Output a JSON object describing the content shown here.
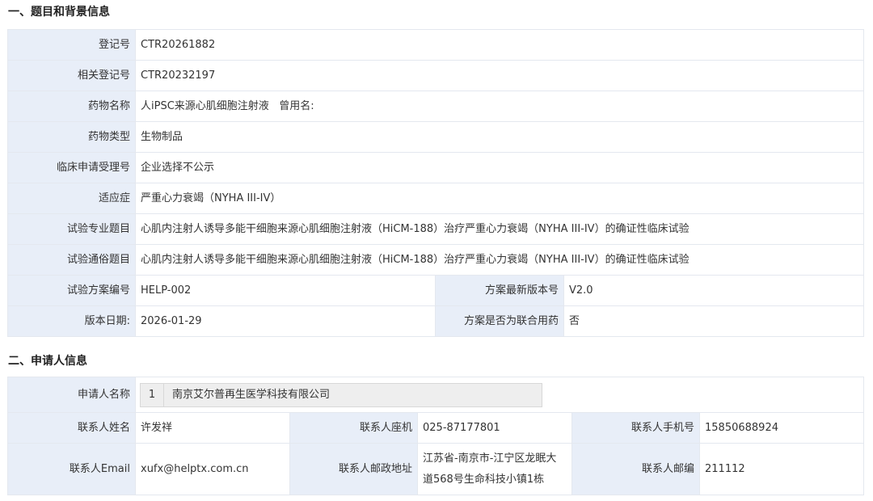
{
  "section1": {
    "title": "一、题目和背景信息",
    "registration_no": {
      "label": "登记号",
      "value": "CTR20261882"
    },
    "related_registration_no": {
      "label": "相关登记号",
      "value": "CTR20232197"
    },
    "drug_name": {
      "label": "药物名称",
      "value": "人iPSC来源心肌细胞注射液",
      "alias_label": "曾用名:",
      "alias_value": ""
    },
    "drug_type": {
      "label": "药物类型",
      "value": "生物制品"
    },
    "clinical_application_no": {
      "label": "临床申请受理号",
      "value": "企业选择不公示"
    },
    "indication": {
      "label": "适应症",
      "value": "严重心力衰竭（NYHA III-IV）"
    },
    "professional_title": {
      "label": "试验专业题目",
      "value": "心肌内注射人诱导多能干细胞来源心肌细胞注射液（HiCM-188）治疗严重心力衰竭（NYHA III-IV）的确证性临床试验"
    },
    "popular_title": {
      "label": "试验通俗题目",
      "value": "心肌内注射人诱导多能干细胞来源心肌细胞注射液（HiCM-188）治疗严重心力衰竭（NYHA III-IV）的确证性临床试验"
    },
    "protocol_no": {
      "label": "试验方案编号",
      "value": "HELP-002"
    },
    "latest_version": {
      "label": "方案最新版本号",
      "value": "V2.0"
    },
    "version_date": {
      "label": "版本日期:",
      "value": "2026-01-29"
    },
    "combination": {
      "label": "方案是否为联合用药",
      "value": "否"
    }
  },
  "section2": {
    "title": "二、申请人信息",
    "applicant": {
      "label": "申请人名称",
      "index": "1",
      "value": "南京艾尔普再生医学科技有限公司"
    },
    "contact_name": {
      "label": "联系人姓名",
      "value": "许发祥"
    },
    "contact_phone": {
      "label": "联系人座机",
      "value": "025-87177801"
    },
    "contact_mobile": {
      "label": "联系人手机号",
      "value": "15850688924"
    },
    "contact_email": {
      "label": "联系人Email",
      "value": "xufx@helptx.com.cn"
    },
    "contact_address": {
      "label": "联系人邮政地址",
      "value": "江苏省-南京市-江宁区龙眠大道568号生命科技小镇1栋"
    },
    "contact_postcode": {
      "label": "联系人邮编",
      "value": "211112"
    }
  }
}
